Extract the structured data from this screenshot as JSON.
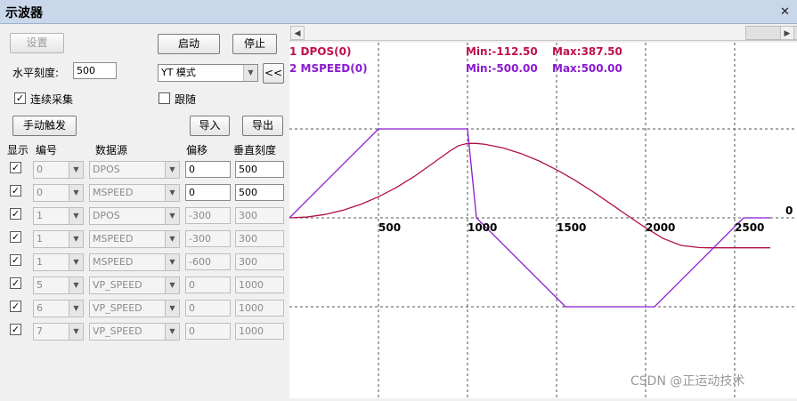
{
  "window": {
    "title": "示波器",
    "close_glyph": "✕"
  },
  "toolbar": {
    "settings": "设置",
    "start": "启动",
    "stop": "停止",
    "h_scale_label": "水平刻度:",
    "h_scale_value": "500",
    "mode": "YT 模式",
    "collapse": "<<",
    "continuous": "连续采集",
    "continuous_checked": true,
    "follow": "跟随",
    "follow_checked": false,
    "manual_trigger": "手动触发",
    "import": "导入",
    "export": "导出"
  },
  "channels": {
    "headers": [
      "显示",
      "编号",
      "数据源",
      "偏移",
      "垂直刻度"
    ],
    "rows": [
      {
        "show": true,
        "num": "0",
        "src": "DPOS",
        "offset": "0",
        "scale": "500",
        "editable": true
      },
      {
        "show": true,
        "num": "0",
        "src": "MSPEED",
        "offset": "0",
        "scale": "500",
        "editable": true
      },
      {
        "show": true,
        "num": "1",
        "src": "DPOS",
        "offset": "-300",
        "scale": "300",
        "editable": false
      },
      {
        "show": true,
        "num": "1",
        "src": "MSPEED",
        "offset": "-300",
        "scale": "300",
        "editable": false
      },
      {
        "show": true,
        "num": "1",
        "src": "MSPEED",
        "offset": "-600",
        "scale": "300",
        "editable": false
      },
      {
        "show": true,
        "num": "5",
        "src": "VP_SPEED",
        "offset": "0",
        "scale": "1000",
        "editable": false
      },
      {
        "show": true,
        "num": "6",
        "src": "VP_SPEED",
        "offset": "0",
        "scale": "1000",
        "editable": false
      },
      {
        "show": true,
        "num": "7",
        "src": "VP_SPEED",
        "offset": "0",
        "scale": "1000",
        "editable": false
      }
    ]
  },
  "legend": [
    {
      "label": "1 DPOS(0)",
      "min": "Min:-112.50",
      "max": "Max:387.50",
      "color": "#c0104a"
    },
    {
      "label": "2 MSPEED(0)",
      "min": "Min:-500.00",
      "max": "Max:500.00",
      "color": "#8a1ad0"
    }
  ],
  "chart_data": {
    "type": "line",
    "x_ticks": [
      "500",
      "1000",
      "1500",
      "2000",
      "2500"
    ],
    "y_zero_label": "0",
    "series": [
      {
        "name": "1 DPOS(0)",
        "color": "#b01040",
        "points": [
          [
            0,
            0
          ],
          [
            100,
            9.5
          ],
          [
            200,
            38
          ],
          [
            300,
            85
          ],
          [
            400,
            151
          ],
          [
            500,
            237
          ],
          [
            600,
            341
          ],
          [
            700,
            464
          ],
          [
            800,
            606
          ],
          [
            900,
            750
          ],
          [
            950,
            812
          ],
          [
            1000,
            837
          ],
          [
            1050,
            837
          ],
          [
            1100,
            826
          ],
          [
            1200,
            786
          ],
          [
            1300,
            723
          ],
          [
            1400,
            641
          ],
          [
            1500,
            541
          ],
          [
            1600,
            427
          ],
          [
            1700,
            300
          ],
          [
            1800,
            163
          ],
          [
            1900,
            24
          ],
          [
            2000,
            -112
          ],
          [
            2100,
            -233
          ],
          [
            2200,
            -311
          ],
          [
            2300,
            -334
          ],
          [
            2350,
            -337
          ],
          [
            2700,
            -337
          ]
        ]
      },
      {
        "name": "2 MSPEED(0)",
        "color": "#8a1ad0",
        "points": [
          [
            0,
            0
          ],
          [
            500,
            1000
          ],
          [
            1000,
            1000
          ],
          [
            1050,
            0
          ],
          [
            1550,
            -1000
          ],
          [
            2050,
            -1000
          ],
          [
            2550,
            0
          ],
          [
            2700,
            0
          ]
        ]
      }
    ],
    "value_per_division": 1000
  },
  "watermark": "CSDN @正运动技术"
}
